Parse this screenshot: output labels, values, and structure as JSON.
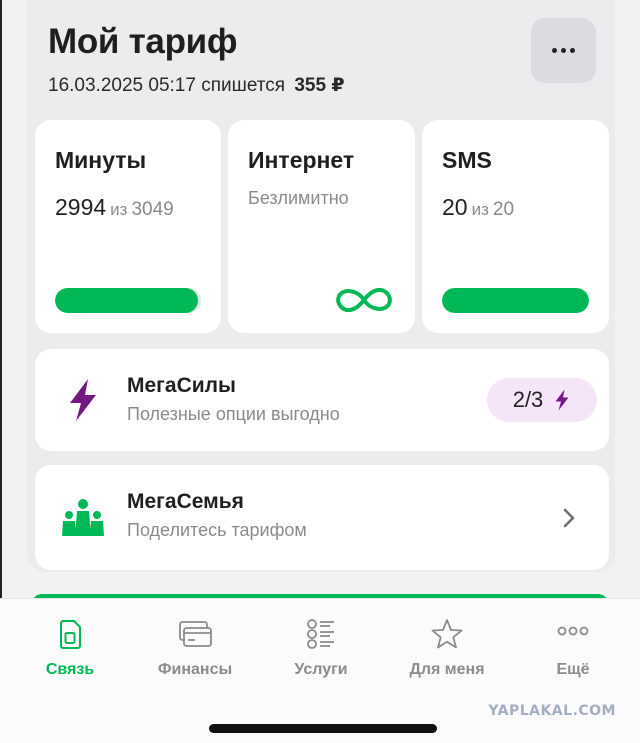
{
  "header": {
    "title": "Мой тариф",
    "charge_text": "16.03.2025 05:17 спишется",
    "charge_amount": "355 ₽",
    "more_icon": "more-horizontal-icon"
  },
  "usage": {
    "minutes": {
      "label": "Минуты",
      "remaining": "2994",
      "of": "из",
      "total": "3049",
      "fraction_remaining": 0.98
    },
    "internet": {
      "label": "Интернет",
      "status": "Безлимитно",
      "icon": "infinity-icon"
    },
    "sms": {
      "label": "SMS",
      "remaining": "20",
      "of": "из",
      "total": "20",
      "fraction_remaining": 1.0
    }
  },
  "megasily": {
    "title": "МегаСилы",
    "subtitle": "Полезные опции выгодно",
    "counter": "2/3",
    "icon": "lightning-icon"
  },
  "megasemya": {
    "title": "МегаСемья",
    "subtitle": "Поделитесь тарифом",
    "icon": "family-icon"
  },
  "tabbar": {
    "items": [
      {
        "label": "Связь",
        "icon": "sim-card-icon",
        "active": true
      },
      {
        "label": "Финансы",
        "icon": "credit-card-icon",
        "active": false
      },
      {
        "label": "Услуги",
        "icon": "services-list-icon",
        "active": false
      },
      {
        "label": "Для меня",
        "icon": "star-icon",
        "active": false
      },
      {
        "label": "Ещё",
        "icon": "more-dots-icon",
        "active": false
      }
    ]
  },
  "colors": {
    "brand_green": "#00b956",
    "purple_accent": "#731982",
    "pill_background": "#f6e4f8"
  },
  "watermark": "YAPLAKAL.COM"
}
